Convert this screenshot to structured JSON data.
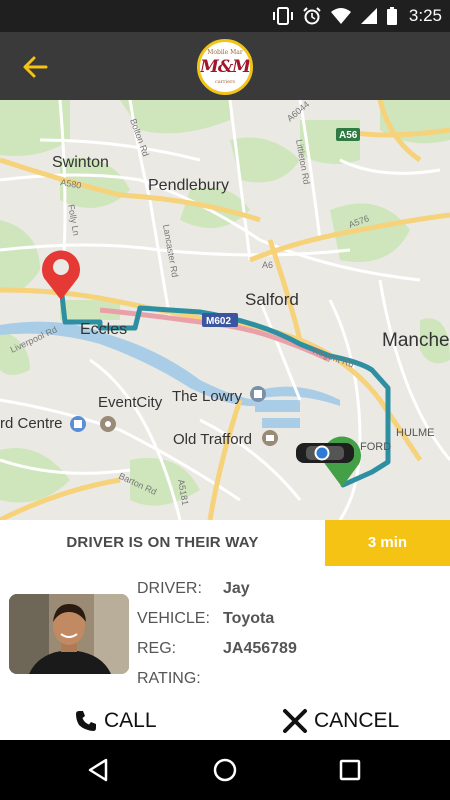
{
  "status_bar": {
    "time": "3:25",
    "icons": [
      "vibrate-icon",
      "alarm-icon",
      "wifi-icon",
      "signal-icon",
      "battery-icon"
    ]
  },
  "app_bar": {
    "back_icon": "arrow-left-icon",
    "logo": {
      "top": "Mobile Mar",
      "main": "M&M",
      "bottom": "carriers"
    },
    "accent_color": "#f5c313"
  },
  "map": {
    "labels": {
      "swinton": "Swinton",
      "pendlebury": "Pendlebury",
      "salford": "Salford",
      "eccles": "Eccles",
      "manchester": "Manche",
      "eventcity": "EventCity",
      "lowry": "The Lowry",
      "old_trafford": "Old Trafford",
      "trafford_centre": "rd Centre",
      "hulme": "HULME",
      "ford": "FORD",
      "m602": "M602",
      "a56": "A56",
      "a6044": "A6044",
      "a576": "A576",
      "a580": "A580",
      "a6": "A6",
      "bolton_rd": "Bolton Rd",
      "lancaster_rd": "Lancaster Rd",
      "littleton_rd": "Littleton Rd",
      "folly_ln": "Folly Ln",
      "liverpool_rd": "Liverpool Rd",
      "regent_rd": "Regent Rd",
      "barton_rd": "Barton Rd",
      "a5181": "A5181"
    },
    "route_color": "#2e8fa3",
    "pickup_color": "#e53935",
    "dropoff_color": "#43a047"
  },
  "trip": {
    "status": "DRIVER IS ON THEIR WAY",
    "eta": "3 min"
  },
  "driver": {
    "driver_label": "DRIVER:",
    "driver_name": "Jay",
    "vehicle_label": "VEHICLE:",
    "vehicle": "Toyota",
    "reg_label": "REG:",
    "reg": "JA456789",
    "rating_label": "RATING:"
  },
  "actions": {
    "call": "CALL",
    "cancel": "CANCEL"
  },
  "nav": {
    "back": "nav-back-icon",
    "home": "nav-home-icon",
    "recents": "nav-recents-icon"
  }
}
